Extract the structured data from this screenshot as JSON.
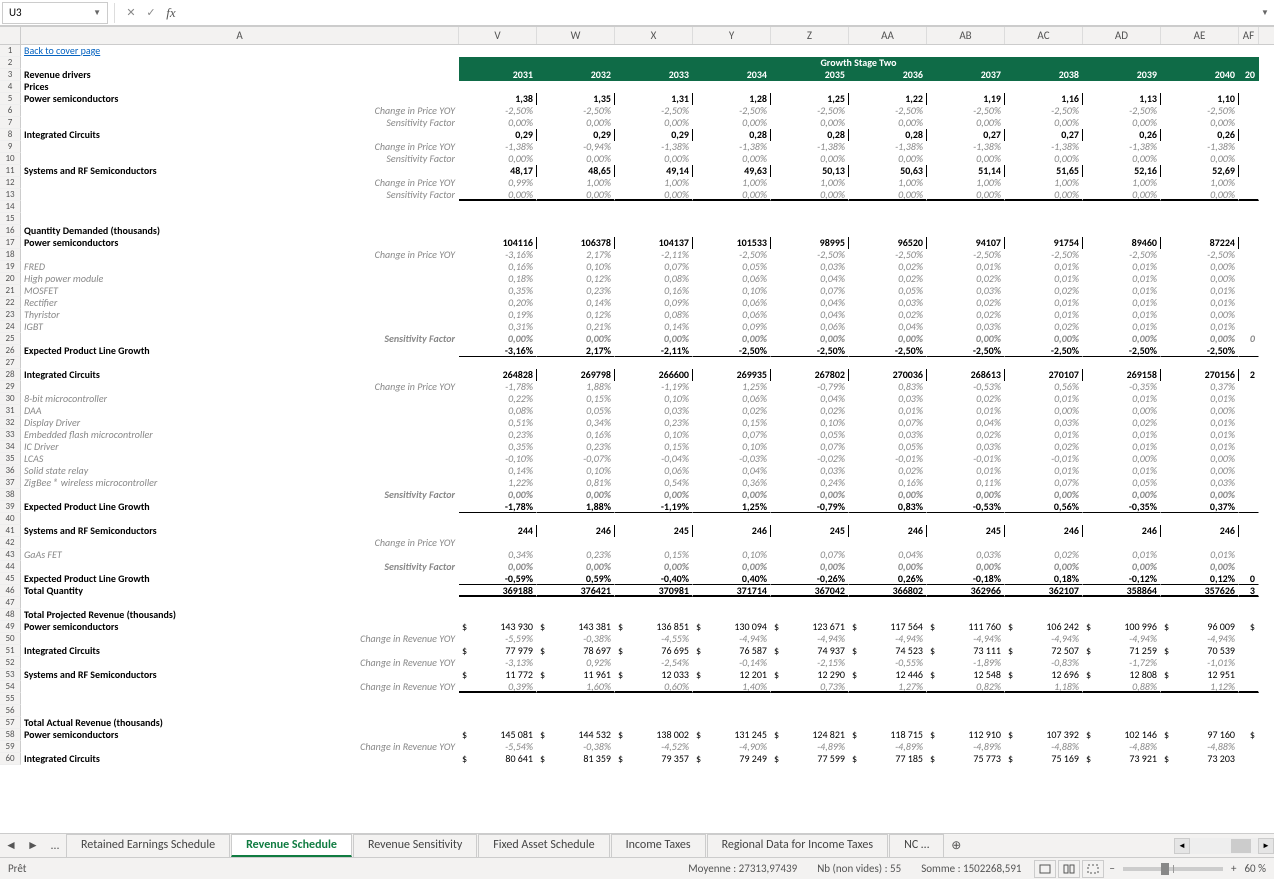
{
  "formula_bar": {
    "cell_ref": "U3",
    "cancel": "✕",
    "accept": "✓",
    "fx": "fx",
    "formula": ""
  },
  "columns": [
    "A",
    "V",
    "W",
    "X",
    "Y",
    "Z",
    "AA",
    "AB",
    "AC",
    "AD",
    "AE",
    "AF"
  ],
  "band_title": "Growth Stage Two",
  "years": [
    "2031",
    "2032",
    "2033",
    "2034",
    "2035",
    "2036",
    "2037",
    "2038",
    "2039",
    "2040",
    "20"
  ],
  "labels": {
    "back": "Back to cover page",
    "revdrivers": "Revenue drivers",
    "prices": "Prices",
    "power": "Power semiconductors",
    "chg_price": "Change in Price YOY",
    "sens": "Sensitivity Factor",
    "ic": "Integrated Circuits",
    "srf": "Systems and RF Semiconductors",
    "qty": "Quantity Demanded (thousands)",
    "fred": "FRED",
    "hpm": "High power module",
    "mosfet": "MOSFET",
    "rect": "Rectifier",
    "thyr": "Thyristor",
    "igbt": "IGBT",
    "eplg": "Expected Product Line Growth",
    "eightbit": "8-bit microcontroller",
    "daa": "DAA",
    "disp": "Display Driver",
    "efm": "Embedded flash microcontroller",
    "icd": "IC Driver",
    "lcas": "LCAS",
    "ssr": "Solid state relay",
    "zig": "ZigBee ® wireless microcontroller",
    "gaas": "GaAs FET",
    "totq": "Total Quantity",
    "tpr": "Total Projected Revenue (thousands)",
    "chg_rev": "Change in Revenue YOY",
    "tar": "Total Actual Revenue (thousands)",
    "intcirc": "Integrated Circuits"
  },
  "rows": {
    "r5": [
      "1,38",
      "1,35",
      "1,31",
      "1,28",
      "1,25",
      "1,22",
      "1,19",
      "1,16",
      "1,13",
      "1,10",
      ""
    ],
    "r6": [
      "-2,50%",
      "-2,50%",
      "-2,50%",
      "-2,50%",
      "-2,50%",
      "-2,50%",
      "-2,50%",
      "-2,50%",
      "-2,50%",
      "-2,50%",
      ""
    ],
    "r7": [
      "0,00%",
      "0,00%",
      "0,00%",
      "0,00%",
      "0,00%",
      "0,00%",
      "0,00%",
      "0,00%",
      "0,00%",
      "0,00%",
      ""
    ],
    "r8": [
      "0,29",
      "0,29",
      "0,29",
      "0,28",
      "0,28",
      "0,28",
      "0,27",
      "0,27",
      "0,26",
      "0,26",
      ""
    ],
    "r9": [
      "-1,38%",
      "-0,94%",
      "-1,38%",
      "-1,38%",
      "-1,38%",
      "-1,38%",
      "-1,38%",
      "-1,38%",
      "-1,38%",
      "-1,38%",
      ""
    ],
    "r10": [
      "0,00%",
      "0,00%",
      "0,00%",
      "0,00%",
      "0,00%",
      "0,00%",
      "0,00%",
      "0,00%",
      "0,00%",
      "0,00%",
      ""
    ],
    "r11": [
      "48,17",
      "48,65",
      "49,14",
      "49,63",
      "50,13",
      "50,63",
      "51,14",
      "51,65",
      "52,16",
      "52,69",
      ""
    ],
    "r12": [
      "0,99%",
      "1,00%",
      "1,00%",
      "1,00%",
      "1,00%",
      "1,00%",
      "1,00%",
      "1,00%",
      "1,00%",
      "1,00%",
      ""
    ],
    "r13": [
      "0,00%",
      "0,00%",
      "0,00%",
      "0,00%",
      "0,00%",
      "0,00%",
      "0,00%",
      "0,00%",
      "0,00%",
      "0,00%",
      ""
    ],
    "r17": [
      "104116",
      "106378",
      "104137",
      "101533",
      "98995",
      "96520",
      "94107",
      "91754",
      "89460",
      "87224",
      ""
    ],
    "r18": [
      "-3,16%",
      "2,17%",
      "-2,11%",
      "-2,50%",
      "-2,50%",
      "-2,50%",
      "-2,50%",
      "-2,50%",
      "-2,50%",
      "-2,50%",
      ""
    ],
    "r19": [
      "0,16%",
      "0,10%",
      "0,07%",
      "0,05%",
      "0,03%",
      "0,02%",
      "0,01%",
      "0,01%",
      "0,01%",
      "0,00%",
      ""
    ],
    "r20": [
      "0,18%",
      "0,12%",
      "0,08%",
      "0,06%",
      "0,04%",
      "0,02%",
      "0,02%",
      "0,01%",
      "0,01%",
      "0,00%",
      ""
    ],
    "r21": [
      "0,35%",
      "0,23%",
      "0,16%",
      "0,10%",
      "0,07%",
      "0,05%",
      "0,03%",
      "0,02%",
      "0,01%",
      "0,01%",
      ""
    ],
    "r22": [
      "0,20%",
      "0,14%",
      "0,09%",
      "0,06%",
      "0,04%",
      "0,03%",
      "0,02%",
      "0,01%",
      "0,01%",
      "0,01%",
      ""
    ],
    "r23": [
      "0,19%",
      "0,12%",
      "0,08%",
      "0,06%",
      "0,04%",
      "0,02%",
      "0,02%",
      "0,01%",
      "0,01%",
      "0,00%",
      ""
    ],
    "r24": [
      "0,31%",
      "0,21%",
      "0,14%",
      "0,09%",
      "0,06%",
      "0,04%",
      "0,03%",
      "0,02%",
      "0,01%",
      "0,01%",
      ""
    ],
    "r25": [
      "0,00%",
      "0,00%",
      "0,00%",
      "0,00%",
      "0,00%",
      "0,00%",
      "0,00%",
      "0,00%",
      "0,00%",
      "0,00%",
      "0"
    ],
    "r26": [
      "-3,16%",
      "2,17%",
      "-2,11%",
      "-2,50%",
      "-2,50%",
      "-2,50%",
      "-2,50%",
      "-2,50%",
      "-2,50%",
      "-2,50%",
      ""
    ],
    "r28": [
      "264828",
      "269798",
      "266600",
      "269935",
      "267802",
      "270036",
      "268613",
      "270107",
      "269158",
      "270156",
      "2"
    ],
    "r29": [
      "-1,78%",
      "1,88%",
      "-1,19%",
      "1,25%",
      "-0,79%",
      "0,83%",
      "-0,53%",
      "0,56%",
      "-0,35%",
      "0,37%",
      ""
    ],
    "r30": [
      "0,22%",
      "0,15%",
      "0,10%",
      "0,06%",
      "0,04%",
      "0,03%",
      "0,02%",
      "0,01%",
      "0,01%",
      "0,01%",
      ""
    ],
    "r31": [
      "0,08%",
      "0,05%",
      "0,03%",
      "0,02%",
      "0,02%",
      "0,01%",
      "0,01%",
      "0,00%",
      "0,00%",
      "0,00%",
      ""
    ],
    "r32": [
      "0,51%",
      "0,34%",
      "0,23%",
      "0,15%",
      "0,10%",
      "0,07%",
      "0,04%",
      "0,03%",
      "0,02%",
      "0,01%",
      ""
    ],
    "r33": [
      "0,23%",
      "0,16%",
      "0,10%",
      "0,07%",
      "0,05%",
      "0,03%",
      "0,02%",
      "0,01%",
      "0,01%",
      "0,01%",
      ""
    ],
    "r34": [
      "0,35%",
      "0,23%",
      "0,15%",
      "0,10%",
      "0,07%",
      "0,05%",
      "0,03%",
      "0,02%",
      "0,01%",
      "0,01%",
      ""
    ],
    "r35": [
      "-0,10%",
      "-0,07%",
      "-0,04%",
      "-0,03%",
      "-0,02%",
      "-0,01%",
      "-0,01%",
      "-0,01%",
      "0,00%",
      "0,00%",
      ""
    ],
    "r36": [
      "0,14%",
      "0,10%",
      "0,06%",
      "0,04%",
      "0,03%",
      "0,02%",
      "0,01%",
      "0,01%",
      "0,01%",
      "0,00%",
      ""
    ],
    "r37": [
      "1,22%",
      "0,81%",
      "0,54%",
      "0,36%",
      "0,24%",
      "0,16%",
      "0,11%",
      "0,07%",
      "0,05%",
      "0,03%",
      ""
    ],
    "r38": [
      "0,00%",
      "0,00%",
      "0,00%",
      "0,00%",
      "0,00%",
      "0,00%",
      "0,00%",
      "0,00%",
      "0,00%",
      "0,00%",
      ""
    ],
    "r39": [
      "-1,78%",
      "1,88%",
      "-1,19%",
      "1,25%",
      "-0,79%",
      "0,83%",
      "-0,53%",
      "0,56%",
      "-0,35%",
      "0,37%",
      ""
    ],
    "r41": [
      "244",
      "246",
      "245",
      "246",
      "245",
      "246",
      "245",
      "246",
      "246",
      "246",
      ""
    ],
    "r43": [
      "0,34%",
      "0,23%",
      "0,15%",
      "0,10%",
      "0,07%",
      "0,04%",
      "0,03%",
      "0,02%",
      "0,01%",
      "0,01%",
      ""
    ],
    "r44": [
      "0,00%",
      "0,00%",
      "0,00%",
      "0,00%",
      "0,00%",
      "0,00%",
      "0,00%",
      "0,00%",
      "0,00%",
      "0,00%",
      ""
    ],
    "r45": [
      "-0,59%",
      "0,59%",
      "-0,40%",
      "0,40%",
      "-0,26%",
      "0,26%",
      "-0,18%",
      "0,18%",
      "-0,12%",
      "0,12%",
      "0"
    ],
    "r46": [
      "369188",
      "376421",
      "370981",
      "371714",
      "367042",
      "366802",
      "362966",
      "362107",
      "358864",
      "357626",
      "3"
    ],
    "r49": [
      "143 930",
      "143 381",
      "136 851",
      "130 094",
      "123 671",
      "117 564",
      "111 760",
      "106 242",
      "100 996",
      "96 009",
      "$"
    ],
    "r50": [
      "-5,59%",
      "-0,38%",
      "-4,55%",
      "-4,94%",
      "-4,94%",
      "-4,94%",
      "-4,94%",
      "-4,94%",
      "-4,94%",
      "-4,94%",
      ""
    ],
    "r51": [
      "77 979",
      "78 697",
      "76 695",
      "76 587",
      "74 937",
      "74 523",
      "73 111",
      "72 507",
      "71 259",
      "70 539",
      ""
    ],
    "r52": [
      "-3,13%",
      "0,92%",
      "-2,54%",
      "-0,14%",
      "-2,15%",
      "-0,55%",
      "-1,89%",
      "-0,83%",
      "-1,72%",
      "-1,01%",
      ""
    ],
    "r53": [
      "11 772",
      "11 961",
      "12 033",
      "12 201",
      "12 290",
      "12 446",
      "12 548",
      "12 696",
      "12 808",
      "12 951",
      ""
    ],
    "r54": [
      "0,39%",
      "1,60%",
      "0,60%",
      "1,40%",
      "0,73%",
      "1,27%",
      "0,82%",
      "1,18%",
      "0,88%",
      "1,12%",
      ""
    ],
    "r58": [
      "145 081",
      "144 532",
      "138 002",
      "131 245",
      "124 821",
      "118 715",
      "112 910",
      "107 392",
      "102 146",
      "97 160",
      "$"
    ],
    "r59": [
      "-5,54%",
      "-0,38%",
      "-4,52%",
      "-4,90%",
      "-4,89%",
      "-4,89%",
      "-4,89%",
      "-4,88%",
      "-4,88%",
      "-4,88%",
      ""
    ],
    "r60": [
      "80 641",
      "81 359",
      "79 357",
      "79 249",
      "77 599",
      "77 185",
      "75 773",
      "75 169",
      "73 921",
      "73 203",
      ""
    ]
  },
  "sheet_tabs": {
    "nav_prev": "◄",
    "nav_next": "►",
    "more": "…",
    "tabs": [
      "Retained Earnings Schedule",
      "Revenue Schedule",
      "Revenue Sensitivity",
      "Fixed Asset Schedule",
      "Income Taxes",
      "Regional Data for Income Taxes",
      "NC …"
    ],
    "active_index": 1,
    "add": "⊕"
  },
  "status": {
    "ready": "Prêt",
    "avg": "Moyenne : 27313,97439",
    "count": "Nb (non vides) : 55",
    "sum": "Somme : 1502268,591",
    "zoom_minus": "−",
    "zoom_plus": "+",
    "zoom": "60 %"
  }
}
